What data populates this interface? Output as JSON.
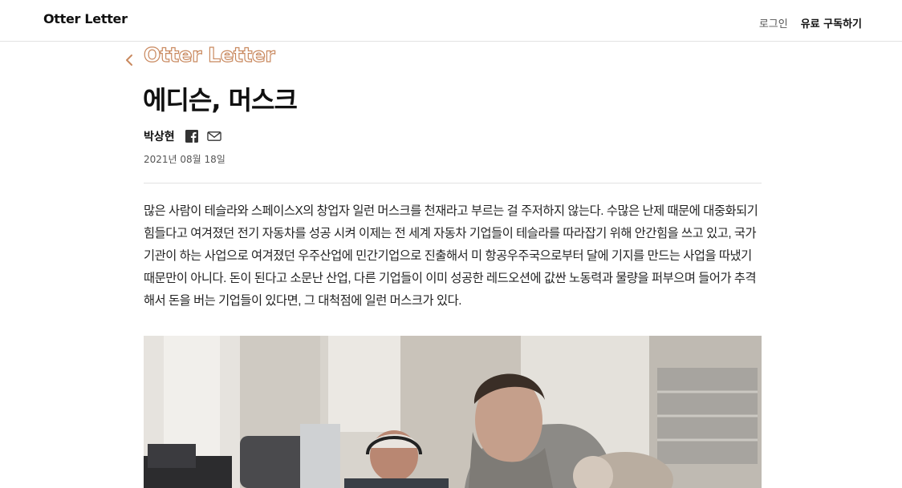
{
  "header": {
    "brand": "Otter Letter",
    "login": "로그인",
    "subscribe": "유료 구독하기"
  },
  "article": {
    "section_logo": "Otter Letter",
    "title": "에디슨, 머스크",
    "author": "박상현",
    "date": "2021년 08월 18일",
    "paragraph": "많은 사람이 테슬라와 스페이스X의 창업자 일런 머스크를 천재라고 부르는 걸 주저하지 않는다. 수많은 난제 때문에 대중화되기 힘들다고 여겨졌던 전기 자동차를 성공 시켜 이제는 전 세계 자동차 기업들이 테슬라를 따라잡기 위해 안간힘을 쓰고 있고, 국가 기관이 하는 사업으로 여겨졌던 우주산업에 민간기업으로 진출해서 미 항공우주국으로부터 달에 기지를 만드는 사업을 따냈기 때문만이 아니다. 돈이 된다고 소문난 산업, 다른 기업들이 이미 성공한 레드오션에 값싼 노동력과 물량을 퍼부으며 들어가 추격해서 돈을 버는 기업들이 있다면, 그 대척점에 일런 머스크가 있다."
  },
  "icons": {
    "back": "chevron-left-icon",
    "facebook": "facebook-icon",
    "email": "mail-icon"
  },
  "colors": {
    "accent": "#c9895f",
    "divider": "#e2e2e2"
  }
}
